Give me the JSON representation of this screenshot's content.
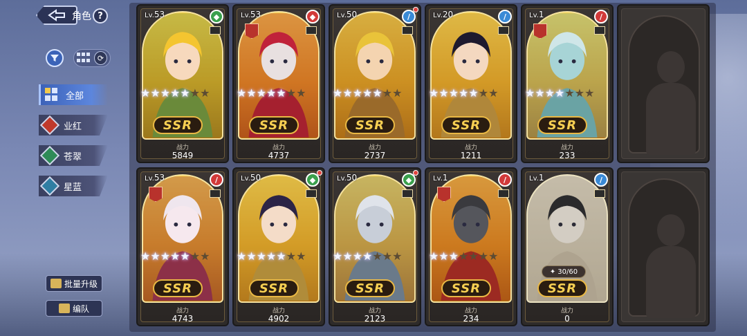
{
  "header": {
    "title": "角色",
    "help_label": "?"
  },
  "toolbar": {
    "sort_symbol": "⟳"
  },
  "tabs": [
    {
      "label": "全部",
      "active": true,
      "color": "#3c62b9"
    },
    {
      "label": "业红",
      "active": false,
      "color": "#c0392b"
    },
    {
      "label": "苍翠",
      "active": false,
      "color": "#2e8b57"
    },
    {
      "label": "星蓝",
      "active": false,
      "color": "#2f7ea3"
    }
  ],
  "buttons": {
    "batch_upgrade": "批量升级",
    "team": "编队"
  },
  "card_common": {
    "lv_prefix": "Lv.",
    "rarity": "SSR",
    "power_label": "战力"
  },
  "characters": [
    {
      "level": "53",
      "type": "green",
      "type_symbol": "◆",
      "stars_lit": 5,
      "power": "5849",
      "hair": "#f4c530",
      "skin": "#f7d9bd",
      "bg": "#6a8a3a",
      "notif": false,
      "shard": ""
    },
    {
      "level": "53",
      "type": "red",
      "type_symbol": "◆",
      "stars_lit": 5,
      "power": "4737",
      "hair": "#c0223a",
      "skin": "#e8e0e0",
      "bg": "#a5202f",
      "notif": false,
      "shard": ""
    },
    {
      "level": "50",
      "type": "blue",
      "type_symbol": "/",
      "stars_lit": 5,
      "power": "2737",
      "hair": "#e9c33a",
      "skin": "#f4d4b0",
      "bg": "#9a6a2a",
      "notif": true,
      "shard": ""
    },
    {
      "level": "20",
      "type": "blue",
      "type_symbol": "/",
      "stars_lit": 5,
      "power": "1211",
      "hair": "#1e1a2e",
      "skin": "#f4d8c0",
      "bg": "#b0873a",
      "notif": false,
      "shard": ""
    },
    {
      "level": "1",
      "type": "red",
      "type_symbol": "/",
      "stars_lit": 4,
      "power": "233",
      "hair": "#cfe6e8",
      "skin": "#a7d4d6",
      "bg": "#6aa3a4",
      "notif": false,
      "shard": ""
    },
    {
      "level": "53",
      "type": "red",
      "type_symbol": "/",
      "stars_lit": 5,
      "power": "4743",
      "hair": "#efe6ee",
      "skin": "#f6e8ee",
      "bg": "#8c3048",
      "notif": false,
      "shard": ""
    },
    {
      "level": "50",
      "type": "green",
      "type_symbol": "◆",
      "stars_lit": 5,
      "power": "4902",
      "hair": "#2c2446",
      "skin": "#f4dcc8",
      "bg": "#b08c3a",
      "notif": true,
      "shard": ""
    },
    {
      "level": "50",
      "type": "green",
      "type_symbol": "◆",
      "stars_lit": 4,
      "power": "2123",
      "hair": "#dfe3ea",
      "skin": "#c8ced8",
      "bg": "#6a7a8a",
      "notif": true,
      "shard": ""
    },
    {
      "level": "1",
      "type": "red",
      "type_symbol": "/",
      "stars_lit": 3,
      "power": "234",
      "hair": "#3a3a3e",
      "skin": "#55565c",
      "bg": "#9c2a22",
      "notif": false,
      "shard": ""
    },
    {
      "level": "1",
      "type": "blue",
      "type_symbol": "/",
      "stars_lit": 0,
      "power": "0",
      "hair": "#2a2a2e",
      "skin": "#d8ccb8",
      "bg": "#b8a27a",
      "notif": false,
      "shard": "30/60"
    }
  ]
}
